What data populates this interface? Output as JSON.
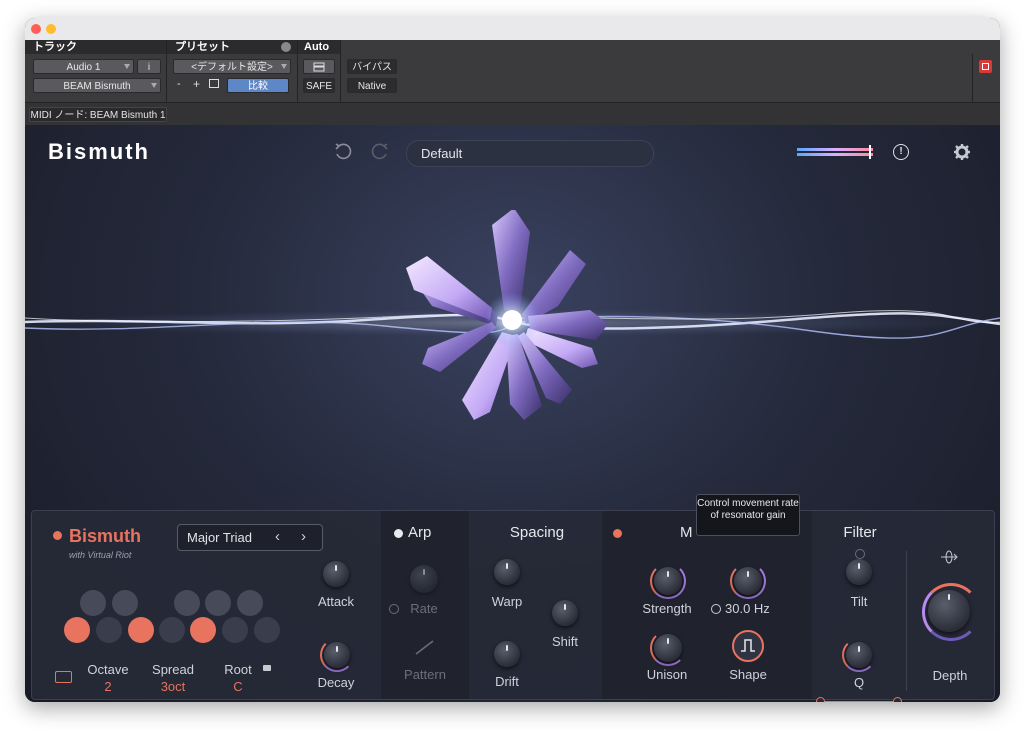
{
  "host": {
    "track_header": "トラック",
    "preset_header": "プリセット",
    "auto_header": "Auto",
    "track_name": "Audio 1",
    "track_info": "i",
    "insert_name": "BEAM Bismuth",
    "preset_name": "<デフォルト設定>",
    "minus": "-",
    "plus": "+",
    "compare": "比較",
    "safe": "SAFE",
    "bypass": "バイパス",
    "native": "Native",
    "midi_node": "MIDI ノード: BEAM Bismuth 1"
  },
  "plugin": {
    "logo": "Bismuth",
    "preset": "Default",
    "warning_icon": "!",
    "colors": {
      "accent": "#e8735f",
      "panel": "#262936",
      "bg": "#1c1f29"
    }
  },
  "left": {
    "title": "Bismuth",
    "subtitle": "with Virtual Riot",
    "chord": "Major Triad",
    "attack": "Attack",
    "decay": "Decay",
    "octave_label": "Octave",
    "octave_value": "2",
    "spread_label": "Spread",
    "spread_value": "3oct",
    "root_label": "Root",
    "root_value": "C"
  },
  "arp": {
    "title": "Arp",
    "rate": "Rate",
    "pattern": "Pattern"
  },
  "spacing": {
    "title": "Spacing",
    "warp": "Warp",
    "shift": "Shift",
    "drift": "Drift"
  },
  "motion": {
    "title": "M",
    "strength": "Strength",
    "rate_value": "30.0 Hz",
    "unison": "Unison",
    "shape": "Shape",
    "tooltip": "Control movement rate of resonator gain"
  },
  "filter": {
    "title": "Filter",
    "tilt": "Tilt",
    "q": "Q"
  },
  "depth": {
    "label": "Depth"
  }
}
